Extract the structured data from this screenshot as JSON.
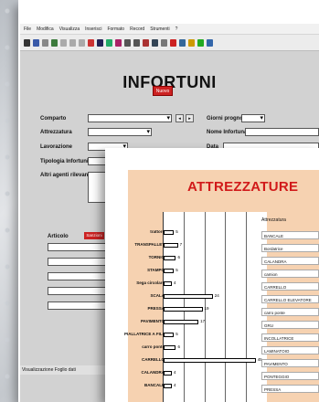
{
  "menu": [
    "File",
    "Modifica",
    "Visualizza",
    "Inserisci",
    "Formato",
    "Record",
    "Strumenti",
    "?"
  ],
  "form": {
    "title": "INFORTUNI",
    "labels": {
      "comparto": "Comparto",
      "attrezzatura": "Attrezzatura",
      "lavorazione": "Lavorazione",
      "tipologia": "Tipologia Infortunio",
      "altri": "Altri agenti rilevanti",
      "giorni": "Giorni prognosi",
      "nome": "Nome Infortunato",
      "data": "Data",
      "articolo": "Articolo"
    },
    "nuovo_label": "Nuovo",
    "sub_label": "Sanzioni",
    "status": "Visualizzazione Foglio dati"
  },
  "chart_data": {
    "type": "bar",
    "title": "ATTREZZATURE",
    "categories": [
      "trattore",
      "TRANSPALLET",
      "TORNIO",
      "STAMPO",
      "Sega circolare",
      "SCALA",
      "PRESSA",
      "PAVIMENTO",
      "PIALLATRICE A FILO",
      "carro ponte",
      "CARRELLO",
      "CALANDRA",
      "BANCALE"
    ],
    "values": [
      5,
      7,
      6,
      5,
      4,
      24,
      19,
      17,
      5,
      6,
      45,
      4,
      4
    ],
    "xlim": [
      0,
      50
    ],
    "legend_title": "Attrezzatura",
    "legend": [
      "BANCALE",
      "Bordatrice",
      "CALANDRA",
      "camion",
      "CARRELLO",
      "CARRELLO ELEVATORE",
      "carro ponte",
      "GRU",
      "INCOLLATRICE",
      "LAMINATOIO",
      "PAVIMENTO",
      "PONTEGGIO",
      "PRESSA"
    ]
  }
}
